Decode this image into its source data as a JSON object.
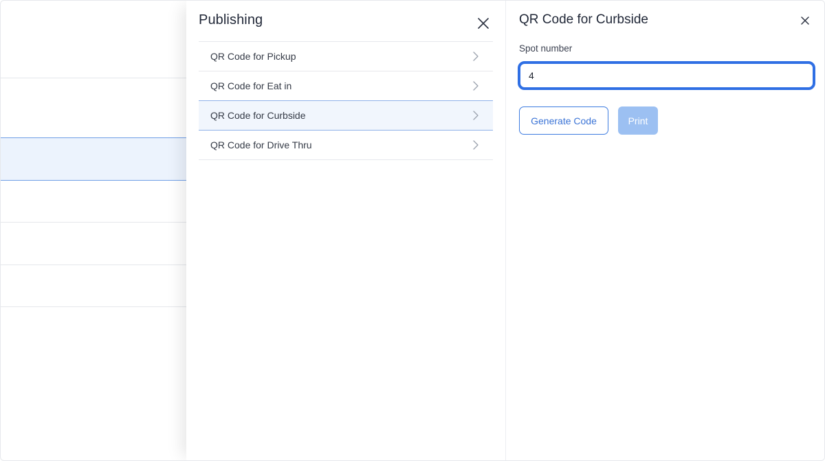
{
  "publishing": {
    "title": "Publishing",
    "items": [
      {
        "label": "QR Code for Pickup",
        "active": false
      },
      {
        "label": "QR Code for Eat in",
        "active": false
      },
      {
        "label": "QR Code for Curbside",
        "active": true
      },
      {
        "label": "QR Code for Drive Thru",
        "active": false
      }
    ]
  },
  "detail": {
    "title": "QR Code for Curbside",
    "field_label": "Spot number",
    "spot_value": "4",
    "generate_label": "Generate Code",
    "print_label": "Print"
  },
  "icons": {
    "publishing_close": "close-icon",
    "detail_close": "close-icon",
    "item_chevron": "chevron-right-icon"
  },
  "colors": {
    "accent": "#2f6fe4",
    "print_disabled": "#9cc0f2",
    "active_row_bg": "#f1f6fd"
  }
}
